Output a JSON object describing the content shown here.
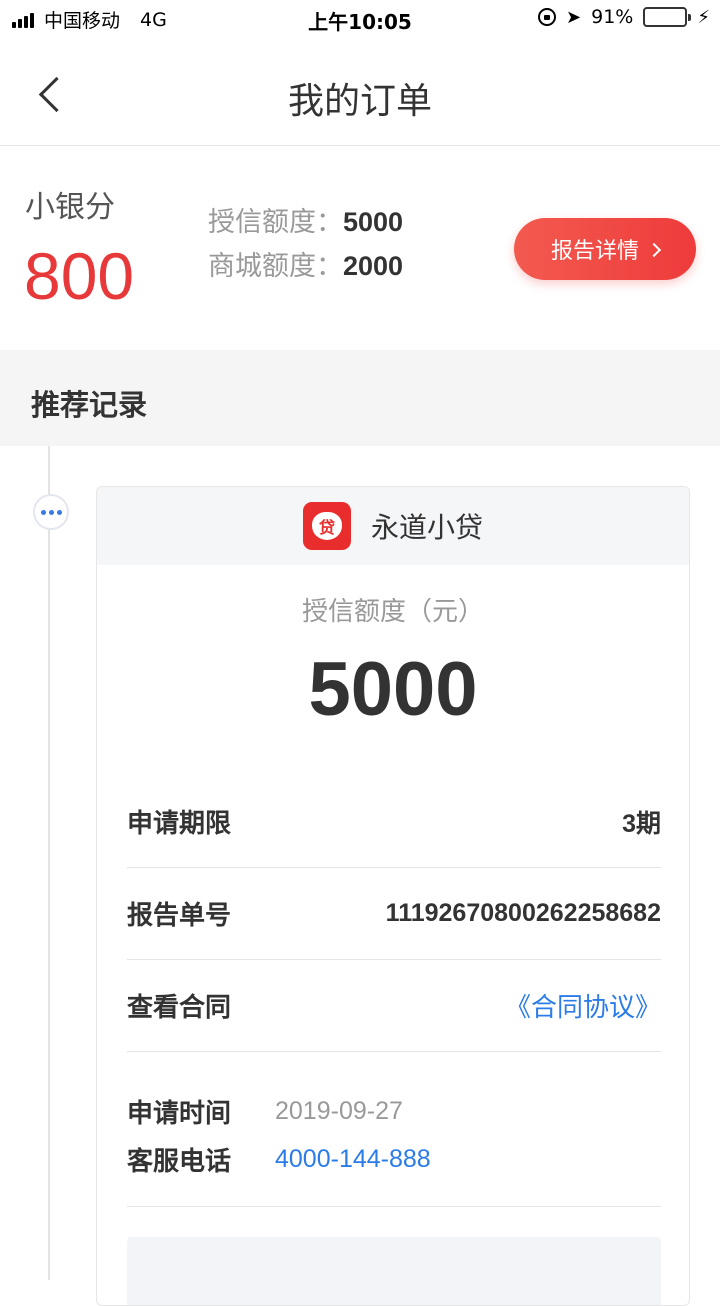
{
  "status_bar": {
    "carrier": "中国移动",
    "network": "4G",
    "time": "上午10:05",
    "battery": "91%",
    "battery_level": 0.91
  },
  "nav": {
    "title": "我的订单"
  },
  "score": {
    "label": "小银分",
    "value": "800",
    "credit_limit_label": "授信额度：",
    "credit_limit_value": "5000",
    "mall_limit_label": "商城额度：",
    "mall_limit_value": "2000",
    "report_button": "报告详情"
  },
  "section": {
    "title": "推荐记录"
  },
  "card": {
    "logo_char": "贷",
    "lender_name": "永道小贷",
    "credit_caption": "授信额度（元）",
    "credit_amount": "5000",
    "rows": [
      {
        "label": "申请期限",
        "value": "3期"
      },
      {
        "label": "报告单号",
        "value": "1119267080026225868​2"
      },
      {
        "label": "查看合同",
        "value": "《合同协议》"
      }
    ],
    "apply_time_label": "申请时间",
    "apply_time_value": "2019-09-27",
    "service_phone_label": "客服电话",
    "service_phone_value": "4000-144-888"
  },
  "colors": {
    "accent_red": "#e8393a",
    "link_blue": "#2b7ce8"
  }
}
